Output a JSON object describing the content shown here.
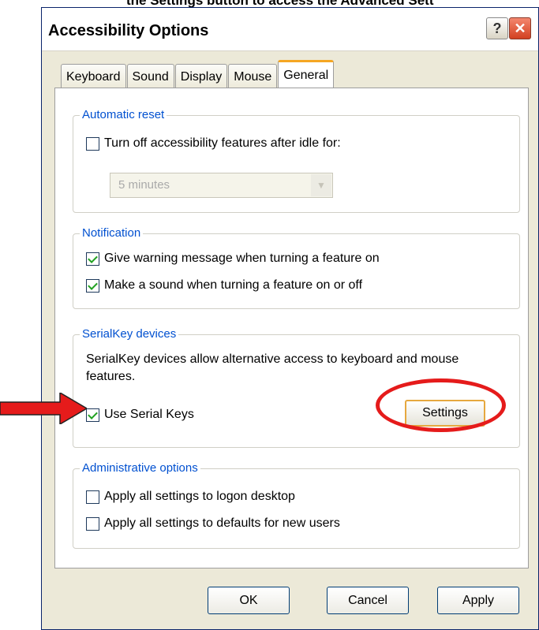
{
  "caption": "the Settings button to access the Advanced Sett",
  "window": {
    "title": "Accessibility Options",
    "help_glyph": "?",
    "close_glyph": "✕"
  },
  "tabs": [
    {
      "label": "Keyboard",
      "active": false
    },
    {
      "label": "Sound",
      "active": false
    },
    {
      "label": "Display",
      "active": false
    },
    {
      "label": "Mouse",
      "active": false
    },
    {
      "label": "General",
      "active": true
    }
  ],
  "automatic_reset": {
    "title": "Automatic reset",
    "checkbox_label": "Turn off accessibility features after idle for:",
    "checked": false,
    "select_value": "5 minutes",
    "select_enabled": false
  },
  "notification": {
    "title": "Notification",
    "items": [
      {
        "label": "Give warning message when turning a feature on",
        "checked": true
      },
      {
        "label": "Make a sound when turning a feature on or off",
        "checked": true
      }
    ]
  },
  "serialkey": {
    "title": "SerialKey devices",
    "description": "SerialKey devices allow alternative access to keyboard and mouse features.",
    "checkbox_label": "Use Serial Keys",
    "checked": true,
    "settings_label": "Settings"
  },
  "administrative": {
    "title": "Administrative options",
    "items": [
      {
        "label": "Apply all settings to logon desktop",
        "checked": false
      },
      {
        "label": "Apply all settings to defaults for new users",
        "checked": false
      }
    ]
  },
  "buttons": {
    "ok": "OK",
    "cancel": "Cancel",
    "apply": "Apply"
  },
  "annotation_colors": {
    "arrow": "#e51b1b",
    "ring": "#e51b1b"
  }
}
